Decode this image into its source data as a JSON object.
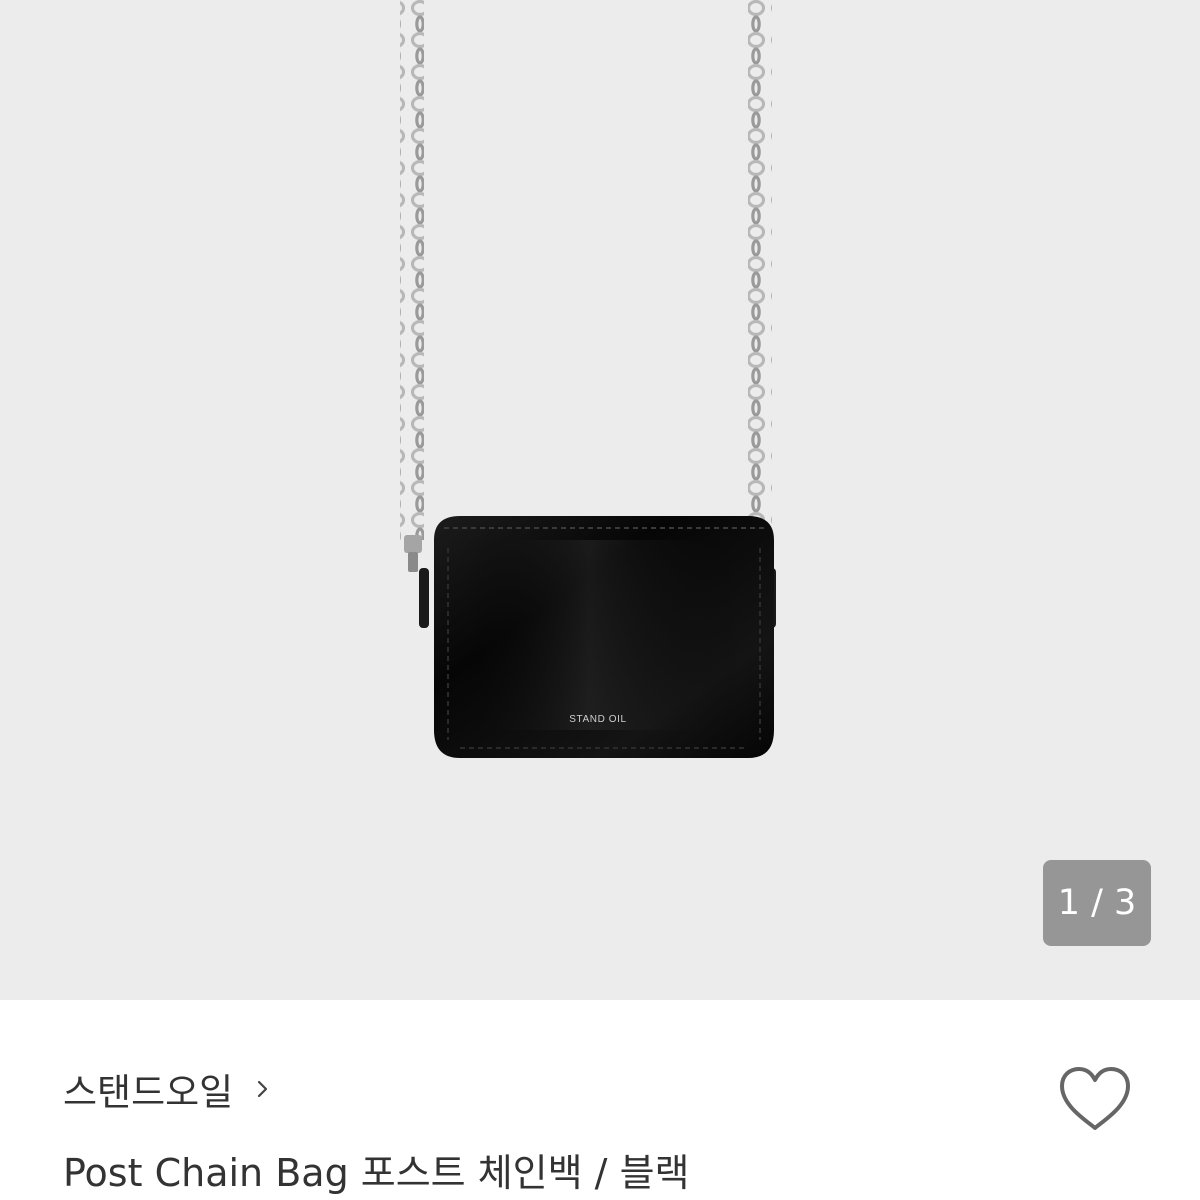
{
  "product_image": {
    "icon": "crossbody-chain-bag-image",
    "logo_text": "STAND OIL"
  },
  "gallery": {
    "counter_text": "1 / 3"
  },
  "product": {
    "brand": "스탠드오일",
    "title": "Post Chain Bag 포스트 체인백 / 블랙"
  },
  "icons": {
    "brand_chevron": "chevron-right-icon",
    "like": "heart-outline-icon"
  },
  "colors": {
    "gallery_bg": "#ececec",
    "text": "#333333",
    "counter_bg": "#8a8a8a"
  }
}
